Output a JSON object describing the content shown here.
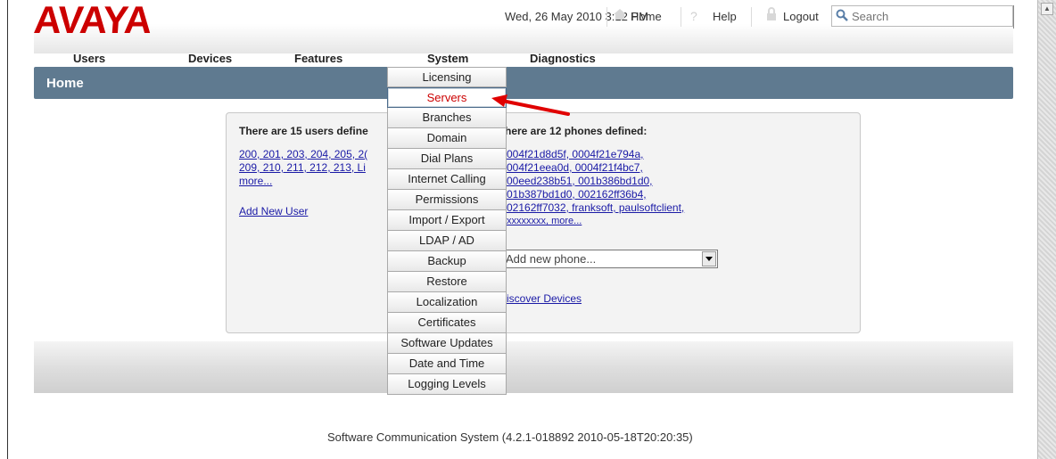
{
  "header": {
    "logo_text": "AVAYA",
    "datetime": "Wed, 26 May 2010 3:12 PM",
    "home_label": "Home",
    "help_label": "Help",
    "logout_label": "Logout",
    "search_placeholder": "Search"
  },
  "nav": {
    "items": [
      {
        "label": "Users"
      },
      {
        "label": "Devices"
      },
      {
        "label": "Features"
      },
      {
        "label": "System"
      },
      {
        "label": "Diagnostics"
      }
    ]
  },
  "system_menu": {
    "items": [
      {
        "label": "Licensing"
      },
      {
        "label": "Servers"
      },
      {
        "label": "Branches"
      },
      {
        "label": "Domain"
      },
      {
        "label": "Dial Plans"
      },
      {
        "label": "Internet Calling"
      },
      {
        "label": "Permissions"
      },
      {
        "label": "Import / Export"
      },
      {
        "label": "LDAP / AD"
      },
      {
        "label": "Backup"
      },
      {
        "label": "Restore"
      },
      {
        "label": "Localization"
      },
      {
        "label": "Certificates"
      },
      {
        "label": "Software Updates"
      },
      {
        "label": "Date and Time"
      },
      {
        "label": "Logging Levels"
      }
    ],
    "highlighted": "Servers"
  },
  "page": {
    "title": "Home"
  },
  "users_panel": {
    "title": "There are 15 users define",
    "line1": "200, 201, 203, 204, 205, 2(",
    "line2": "209, 210, 211, 212, 213, Li",
    "more": "more...",
    "add_link": "Add New User"
  },
  "phones_panel": {
    "title": "here are 12 phones defined:",
    "line1": "004f21d8d5f, 0004f21e794a,",
    "line2": "004f21eea0d, 0004f21f4bc7,",
    "line3": "00eed238b51, 001b386bd1d0,",
    "line4": "01b387bd1d0, 002162ff36b4,",
    "line5": "02162ff7032, franksoft, paulsoftclient,",
    "line6": "xxxxxxxx, more...",
    "select_value": "Add new phone...",
    "discover_link": "iscover Devices"
  },
  "footer": {
    "text": "Software Communication System (4.2.1-018892 2010-05-18T20:20:35)"
  },
  "colors": {
    "brand_red": "#cc0000",
    "header_bar": "#5f7a90",
    "link_blue": "#1a1aa6"
  },
  "icons": [
    "home-icon",
    "help-icon",
    "lock-icon",
    "search-icon",
    "red-arrow-icon",
    "scroll-up-icon",
    "dropdown-arrow-icon"
  ]
}
